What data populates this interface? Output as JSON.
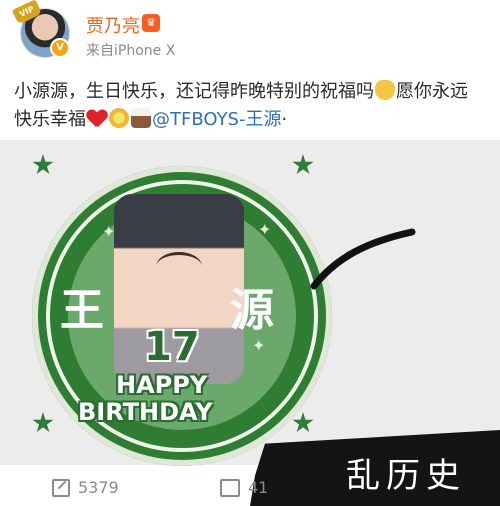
{
  "post": {
    "username": "贾乃亮",
    "vip_label": "♛",
    "source": "来自iPhone X",
    "text_part1": "小源源，生日快乐，还记得昨晚特别的祝福吗",
    "text_part2": "愿你永远快乐幸福",
    "mention": "@TFBOYS-王源",
    "trailing": "·"
  },
  "image": {
    "name_left": "王",
    "name_right": "源",
    "age": "17",
    "happy": "HAPPY",
    "birthday": "BIRTHDAY"
  },
  "footer": {
    "share_count": "5379",
    "comment_count": "41"
  },
  "watermark": {
    "text": "乱历史"
  },
  "icons": [
    "crown-icon",
    "verified-icon",
    "pray-emoji-icon",
    "heart-emoji-icon",
    "flower-emoji-icon",
    "cake-emoji-icon",
    "share-icon",
    "comment-icon",
    "star-icon"
  ]
}
